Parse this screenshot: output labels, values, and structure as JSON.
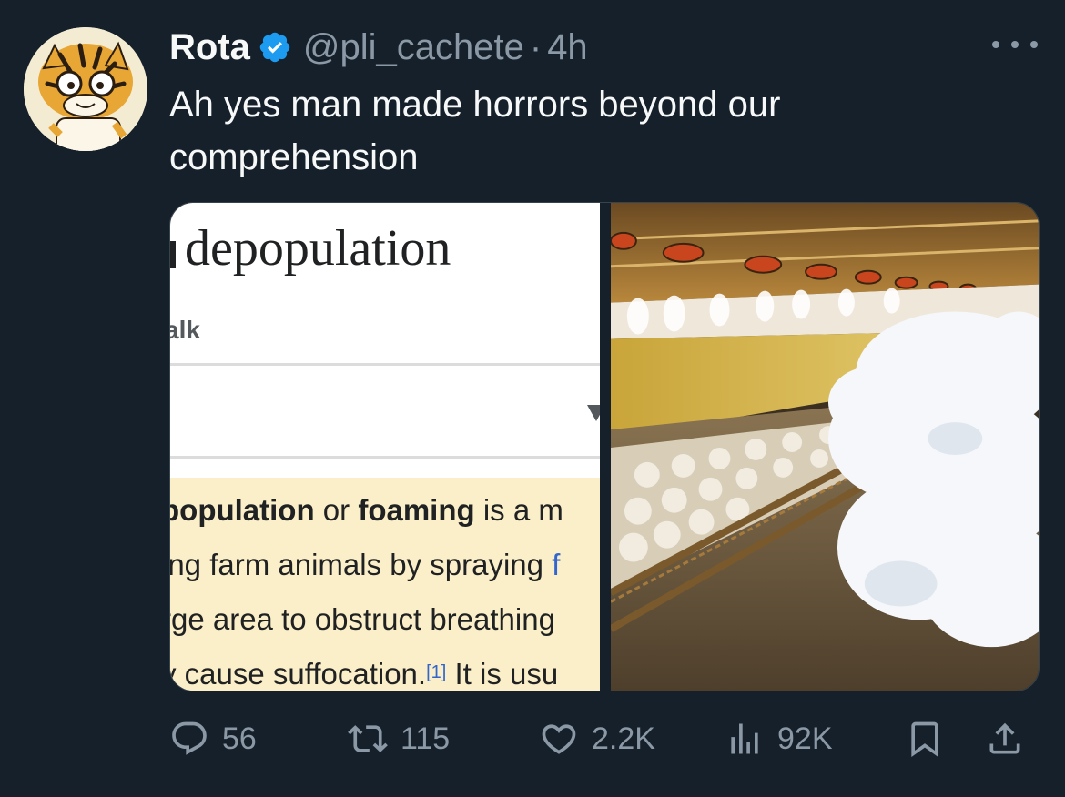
{
  "author": {
    "name": "Rota",
    "handle": "@pli_cachete",
    "separator": "·",
    "time": "4h",
    "verified": true,
    "avatar": "cartoon-tiger-avatar"
  },
  "tweet": {
    "text": "Ah yes man made horrors beyond our comprehension"
  },
  "media": {
    "wiki_screenshot": {
      "title": "depopulation",
      "tab": "alk",
      "lines": [
        {
          "parts": [
            {
              "t": "population",
              "b": true
            },
            {
              "t": " or "
            },
            {
              "t": "foaming",
              "b": true
            },
            {
              "t": " is a m"
            }
          ]
        },
        {
          "parts": [
            {
              "t": "ing farm animals by spraying "
            },
            {
              "t": "f",
              "link": true
            }
          ]
        },
        {
          "parts": [
            {
              "t": "rge area to obstruct breathing"
            }
          ]
        },
        {
          "parts": [
            {
              "t": "y cause suffocation."
            },
            {
              "t": "[1]",
              "sup": true
            },
            {
              "t": " It is usu"
            }
          ]
        }
      ]
    },
    "photo": "poultry-house-foam-photo"
  },
  "actions": {
    "replies": "56",
    "retweets": "115",
    "likes": "2.2K",
    "views": "92K"
  },
  "colors": {
    "background": "#15202b",
    "secondary_text": "#8b98a5",
    "verified_blue": "#1d9bf0",
    "wiki_highlight": "#fbefc9",
    "wiki_link": "#3366cc"
  },
  "icons": [
    "more-icon",
    "verified-badge-icon",
    "reply-icon",
    "retweet-icon",
    "like-icon",
    "views-icon",
    "bookmark-icon",
    "share-icon"
  ]
}
